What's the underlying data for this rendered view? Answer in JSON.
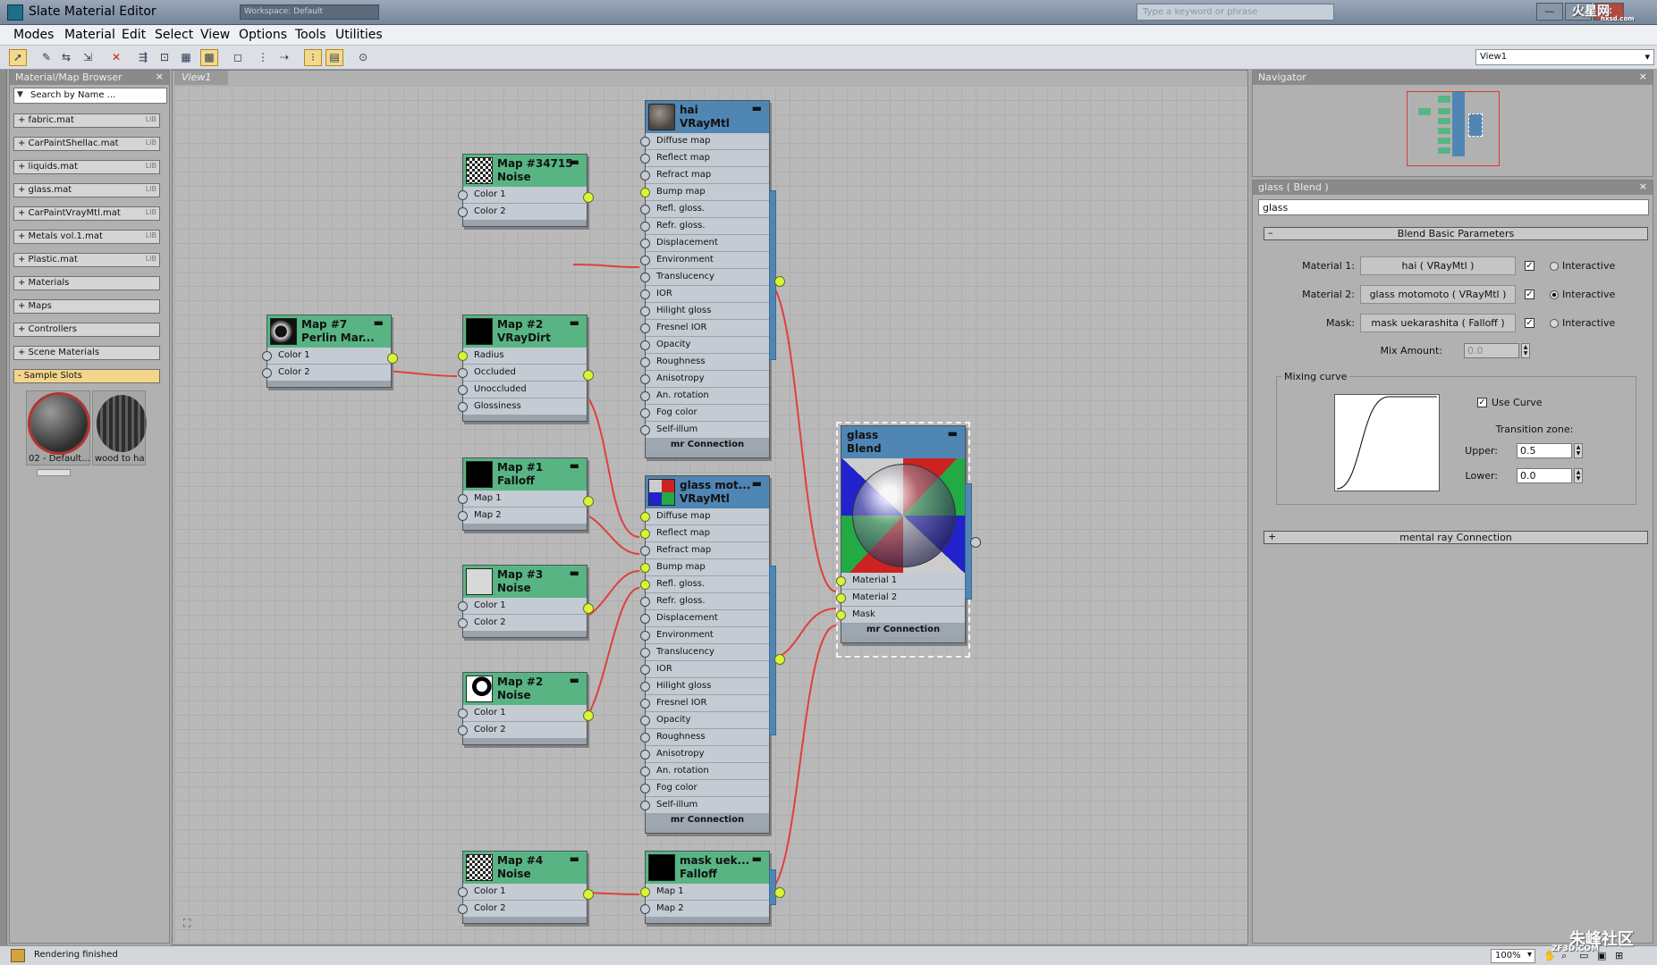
{
  "window": {
    "title": "Slate Material Editor",
    "workspace": "Workspace: Default",
    "help_search_placeholder": "Type a keyword or phrase",
    "controls": [
      "—",
      "□",
      "✕"
    ]
  },
  "menu": [
    "Modes",
    "Material",
    "Edit",
    "Select",
    "View",
    "Options",
    "Tools",
    "Utilities"
  ],
  "toolbar": {
    "icons": [
      "select-tool-icon",
      "pick-material-icon",
      "put-to-scene-icon",
      "assign-to-selection-icon",
      "delete-icon",
      "move-children-icon",
      "hide-unused-nodeslots-icon",
      "show-map-icon",
      "show-background-icon",
      "background-grid-icon",
      "layout-all-icon",
      "layout-children-icon",
      "material-map-browser-icon",
      "parameter-editor-icon",
      "navigator-icon"
    ],
    "view_select": "View1"
  },
  "browser": {
    "title": "Material/Map Browser",
    "close": "×",
    "search_placeholder": "Search by Name ...",
    "groups": [
      {
        "label": "+ fabric.mat",
        "lib": "LIB"
      },
      {
        "label": "+ CarPaintShellac.mat",
        "lib": "LIB"
      },
      {
        "label": "+ liquids.mat",
        "lib": "LIB"
      },
      {
        "label": "+ glass.mat",
        "lib": "LIB"
      },
      {
        "label": "+ CarPaintVrayMtl.mat",
        "lib": "LIB"
      },
      {
        "label": "+ Metals vol.1.mat",
        "lib": "LIB"
      },
      {
        "label": "+ Plastic.mat",
        "lib": "LIB"
      },
      {
        "label": "+ Materials",
        "lib": ""
      },
      {
        "label": "+ Maps",
        "lib": ""
      },
      {
        "label": "+ Controllers",
        "lib": ""
      },
      {
        "label": "+ Scene Materials",
        "lib": ""
      },
      {
        "label": "- Sample Slots",
        "lib": ""
      }
    ],
    "slots": [
      {
        "label": "02 - Default..."
      },
      {
        "label": "wood to ha"
      }
    ]
  },
  "view": {
    "tab": "View1",
    "nodes": {
      "noise34715": {
        "name": "Map #34715",
        "type": "Noise",
        "slots": [
          "Color 1",
          "Color 2"
        ]
      },
      "perlin7": {
        "name": "Map #7",
        "type": "Perlin Mar...",
        "slots": [
          "Color 1",
          "Color 2"
        ]
      },
      "vraydirt2": {
        "name": "Map #2",
        "type": "VRayDirt",
        "slots": [
          "Radius",
          "Occluded",
          "Unoccluded",
          "Glossiness"
        ]
      },
      "falloff1": {
        "name": "Map #1",
        "type": "Falloff",
        "slots": [
          "Map 1",
          "Map 2"
        ]
      },
      "noise3": {
        "name": "Map #3",
        "type": "Noise",
        "slots": [
          "Color 1",
          "Color 2"
        ]
      },
      "noise2": {
        "name": "Map #2",
        "type": "Noise",
        "slots": [
          "Color 1",
          "Color 2"
        ]
      },
      "noise4": {
        "name": "Map #4",
        "type": "Noise",
        "slots": [
          "Color 1",
          "Color 2"
        ]
      },
      "hai": {
        "name": "hai",
        "type": "VRayMtl",
        "slots": [
          "Diffuse map",
          "Reflect map",
          "Refract map",
          "Bump map",
          "Refl. gloss.",
          "Refr. gloss.",
          "Displacement",
          "Environment",
          "Translucency",
          "IOR",
          "Hilight gloss",
          "Fresnel IOR",
          "Opacity",
          "Roughness",
          "Anisotropy",
          "An. rotation",
          "Fog color",
          "Self-illum"
        ],
        "footer": "mr Connection"
      },
      "glassmot": {
        "name": "glass mot...",
        "type": "VRayMtl",
        "slots": [
          "Diffuse map",
          "Reflect map",
          "Refract map",
          "Bump map",
          "Refl. gloss.",
          "Refr. gloss.",
          "Displacement",
          "Environment",
          "Translucency",
          "IOR",
          "Hilight gloss",
          "Fresnel IOR",
          "Opacity",
          "Roughness",
          "Anisotropy",
          "An. rotation",
          "Fog color",
          "Self-illum"
        ],
        "footer": "mr Connection"
      },
      "maskuek": {
        "name": "mask uek...",
        "type": "Falloff",
        "slots": [
          "Map 1",
          "Map 2"
        ]
      },
      "glassblend": {
        "name": "glass",
        "type": "Blend",
        "slots": [
          "Material 1",
          "Material 2",
          "Mask"
        ],
        "footer": "mr Connection"
      }
    }
  },
  "navigator": {
    "title": "Navigator",
    "close": "×"
  },
  "params": {
    "header": "glass  ( Blend )",
    "close": "×",
    "name_value": "glass",
    "rollout_title": "Blend Basic Parameters",
    "rollout_toggle": "–",
    "material1_label": "Material 1:",
    "material1_value": "hai  ( VRayMtl )",
    "material2_label": "Material 2:",
    "material2_value": "glass motomoto  ( VRayMtl )",
    "mask_label": "Mask:",
    "mask_value": "mask uekarashita  ( Falloff )",
    "interactive_label": "Interactive",
    "interactive_states": [
      false,
      true,
      false
    ],
    "mix_amount_label": "Mix Amount:",
    "mix_amount_value": "0.0",
    "mixing_curve_label": "Mixing curve",
    "use_curve_label": "Use Curve",
    "use_curve_checked": true,
    "transition_zone_label": "Transition zone:",
    "upper_label": "Upper:",
    "upper_value": "0.5",
    "lower_label": "Lower:",
    "lower_value": "0.0",
    "mr_rollout_title": "mental ray Connection",
    "mr_rollout_toggle": "+"
  },
  "status": {
    "message": "Rendering finished",
    "zoom": "100%"
  },
  "watermark": {
    "top": "火星网",
    "top_sub": "hxsd.com",
    "bottom": "朱峰社区",
    "bottom_sub": "ZF3D.COM"
  },
  "colors": {
    "map_header": "#58b583",
    "material_header": "#4f86b4",
    "wire": "#e0403c",
    "port_live": "#d9f43a"
  }
}
